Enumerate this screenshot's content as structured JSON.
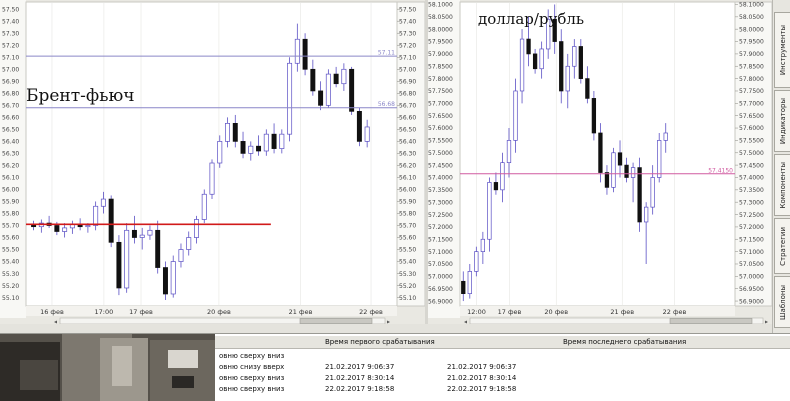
{
  "chart_data": [
    {
      "type": "candlestick",
      "annotation": "Брент-фьюч",
      "x_labels": [
        "17:00",
        "16 фев",
        "17 фев",
        "20 фев",
        "21 фев",
        "22 фев"
      ],
      "y_ticks": [
        "57.50",
        "57.40",
        "57.30",
        "57.20",
        "57.10",
        "57.00",
        "56.90",
        "56.80",
        "56.70",
        "56.60",
        "56.50",
        "56.40",
        "56.30",
        "56.20",
        "56.10",
        "56.00",
        "55.90",
        "55.80",
        "55.70",
        "55.60",
        "55.50",
        "55.40",
        "55.30",
        "55.20",
        "55.10"
      ],
      "ylim": [
        55.03,
        57.56
      ],
      "levels": [
        {
          "value": 57.11,
          "label": "57.11",
          "color": "#8a86c8"
        },
        {
          "value": 56.68,
          "label": "56.68",
          "color": "#8a86c8"
        },
        {
          "value": 55.71,
          "label": "",
          "color": "#d11a1a"
        }
      ],
      "candles": [
        [
          55.71,
          55.74,
          55.66,
          55.69
        ],
        [
          55.69,
          55.75,
          55.64,
          55.72
        ],
        [
          55.72,
          55.78,
          55.68,
          55.7
        ],
        [
          55.7,
          55.73,
          55.62,
          55.65
        ],
        [
          55.65,
          55.72,
          55.6,
          55.68
        ],
        [
          55.68,
          55.74,
          55.63,
          55.71
        ],
        [
          55.71,
          55.76,
          55.66,
          55.69
        ],
        [
          55.69,
          55.72,
          55.64,
          55.7
        ],
        [
          55.7,
          55.9,
          55.66,
          55.86
        ],
        [
          55.86,
          55.98,
          55.8,
          55.92
        ],
        [
          55.92,
          55.95,
          55.52,
          55.56
        ],
        [
          55.56,
          55.62,
          55.12,
          55.18
        ],
        [
          55.18,
          55.72,
          55.14,
          55.66
        ],
        [
          55.66,
          55.78,
          55.55,
          55.6
        ],
        [
          55.6,
          55.68,
          55.5,
          55.62
        ],
        [
          55.62,
          55.7,
          55.58,
          55.66
        ],
        [
          55.66,
          55.74,
          55.3,
          55.35
        ],
        [
          55.35,
          55.4,
          55.08,
          55.13
        ],
        [
          55.13,
          55.45,
          55.1,
          55.4
        ],
        [
          55.4,
          55.55,
          55.35,
          55.5
        ],
        [
          55.5,
          55.65,
          55.45,
          55.6
        ],
        [
          55.6,
          55.78,
          55.55,
          55.75
        ],
        [
          55.75,
          56.0,
          55.72,
          55.96
        ],
        [
          55.96,
          56.25,
          55.92,
          56.22
        ],
        [
          56.22,
          56.45,
          56.18,
          56.4
        ],
        [
          56.4,
          56.6,
          56.35,
          56.55
        ],
        [
          56.55,
          56.62,
          56.35,
          56.4
        ],
        [
          56.4,
          56.48,
          56.26,
          56.3
        ],
        [
          56.3,
          56.4,
          56.24,
          56.36
        ],
        [
          56.36,
          56.45,
          56.28,
          56.32
        ],
        [
          56.32,
          56.5,
          56.28,
          56.46
        ],
        [
          56.46,
          56.55,
          56.3,
          56.34
        ],
        [
          56.34,
          56.5,
          56.3,
          56.46
        ],
        [
          56.46,
          57.1,
          56.4,
          57.05
        ],
        [
          57.05,
          57.38,
          56.98,
          57.25
        ],
        [
          57.25,
          57.3,
          56.95,
          57.0
        ],
        [
          57.0,
          57.08,
          56.78,
          56.82
        ],
        [
          56.82,
          56.9,
          56.66,
          56.7
        ],
        [
          56.7,
          57.0,
          56.68,
          56.96
        ],
        [
          56.96,
          57.02,
          56.85,
          56.88
        ],
        [
          56.88,
          57.05,
          56.82,
          57.0
        ],
        [
          57.0,
          57.02,
          56.62,
          56.65
        ],
        [
          56.65,
          56.68,
          56.36,
          56.4
        ],
        [
          56.4,
          56.58,
          56.35,
          56.52
        ]
      ]
    },
    {
      "type": "candlestick",
      "annotation": "доллар/рубль",
      "x_labels": [
        "12:00",
        "17 фев",
        "20 фев",
        "21 фев",
        "22 фев"
      ],
      "y_ticks": [
        "58.1000",
        "58.0500",
        "58.0000",
        "57.9500",
        "57.9000",
        "57.8500",
        "57.8000",
        "57.7500",
        "57.7000",
        "57.6500",
        "57.6000",
        "57.5500",
        "57.5000",
        "57.4500",
        "57.4000",
        "57.3500",
        "57.3000",
        "57.2500",
        "57.2000",
        "57.1500",
        "57.1000",
        "57.0500",
        "57.0000",
        "56.9500",
        "56.9000"
      ],
      "ylim": [
        56.88,
        58.11
      ],
      "levels": [
        {
          "value": 57.415,
          "label": "57.4150",
          "color": "#d05aa0"
        }
      ],
      "candles": [
        [
          56.98,
          57.02,
          56.9,
          56.93
        ],
        [
          56.93,
          57.05,
          56.91,
          57.02
        ],
        [
          57.02,
          57.12,
          57.0,
          57.1
        ],
        [
          57.1,
          57.18,
          57.05,
          57.15
        ],
        [
          57.15,
          57.4,
          57.1,
          57.38
        ],
        [
          57.38,
          57.42,
          57.33,
          57.35
        ],
        [
          57.35,
          57.5,
          57.3,
          57.46
        ],
        [
          57.46,
          57.6,
          57.4,
          57.55
        ],
        [
          57.55,
          57.8,
          57.5,
          57.75
        ],
        [
          57.75,
          58.0,
          57.7,
          57.96
        ],
        [
          57.96,
          58.05,
          57.85,
          57.9
        ],
        [
          57.9,
          57.92,
          57.82,
          57.84
        ],
        [
          57.84,
          57.95,
          57.8,
          57.92
        ],
        [
          57.92,
          58.08,
          57.88,
          58.04
        ],
        [
          58.04,
          58.1,
          57.9,
          57.95
        ],
        [
          57.95,
          58.0,
          57.7,
          57.75
        ],
        [
          57.75,
          57.9,
          57.68,
          57.85
        ],
        [
          57.85,
          57.96,
          57.8,
          57.93
        ],
        [
          57.93,
          57.96,
          57.78,
          57.8
        ],
        [
          57.8,
          57.85,
          57.7,
          57.72
        ],
        [
          57.72,
          57.75,
          57.55,
          57.58
        ],
        [
          57.58,
          57.62,
          57.38,
          57.42
        ],
        [
          57.42,
          57.45,
          57.33,
          57.36
        ],
        [
          57.36,
          57.52,
          57.34,
          57.5
        ],
        [
          57.5,
          57.55,
          57.4,
          57.45
        ],
        [
          57.45,
          57.48,
          57.38,
          57.4
        ],
        [
          57.4,
          57.46,
          57.3,
          57.44
        ],
        [
          57.44,
          57.48,
          57.18,
          57.22
        ],
        [
          57.22,
          57.3,
          57.05,
          57.28
        ],
        [
          57.28,
          57.45,
          57.25,
          57.4
        ],
        [
          57.4,
          57.58,
          57.38,
          57.55
        ],
        [
          57.55,
          57.62,
          57.5,
          57.58
        ]
      ]
    }
  ],
  "sidebar": {
    "tabs": [
      "Инструменты",
      "Индикаторы",
      "Компоненты",
      "Стратегии",
      "Шаблоны"
    ]
  },
  "alerts_table": {
    "headers": [
      "Время первого срабатывания",
      "Время последнего срабатывания"
    ],
    "rows": [
      {
        "name": "овню сверху вниз",
        "first": "",
        "last": ""
      },
      {
        "name": "овню снизу вверх",
        "first": "21.02.2017 9:06:37",
        "last": "21.02.2017 9:06:37"
      },
      {
        "name": "овню сверху вниз",
        "first": "21.02.2017 8:30:14",
        "last": "21.02.2017 8:30:14"
      },
      {
        "name": "овню сверху вниз",
        "first": "22.02.2017 9:18:58",
        "last": "22.02.2017 9:18:58"
      }
    ]
  }
}
